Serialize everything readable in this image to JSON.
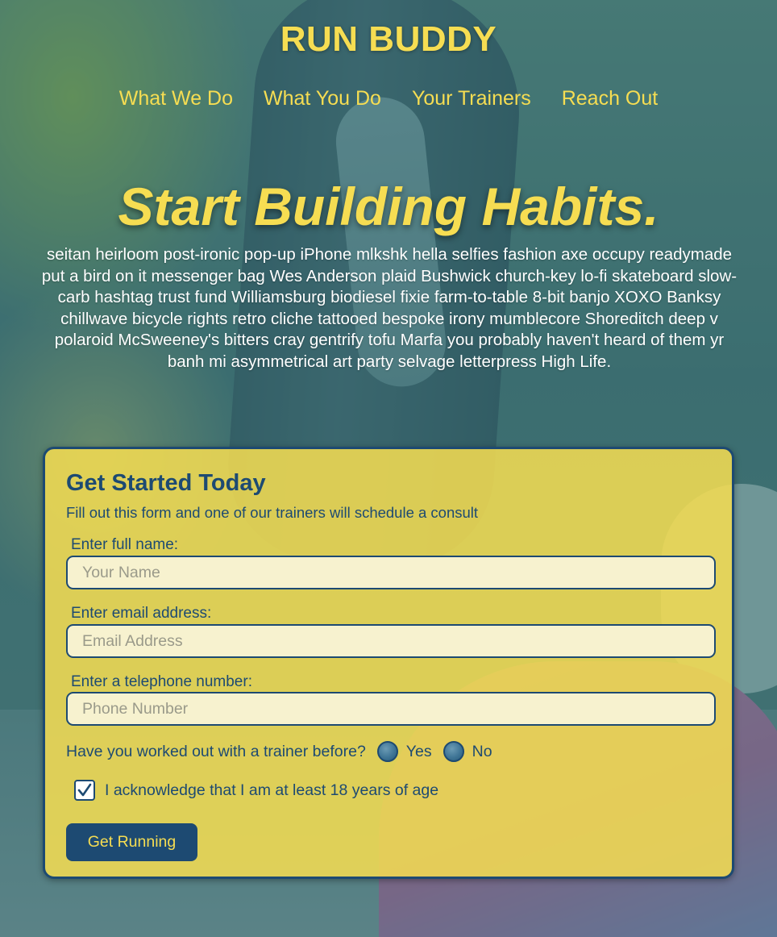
{
  "header": {
    "title": "RUN BUDDY",
    "nav": [
      "What We Do",
      "What You Do",
      "Your Trainers",
      "Reach Out"
    ]
  },
  "hero": {
    "title": "Start Building Habits.",
    "copy": "seitan heirloom post-ironic pop-up iPhone mlkshk hella selfies fashion axe occupy readymade put a bird on it messenger bag Wes Anderson plaid Bushwick church-key lo-fi skateboard slow-carb hashtag trust fund Williamsburg biodiesel fixie farm-to-table 8-bit banjo XOXO Banksy chillwave bicycle rights retro cliche tattooed bespoke irony mumblecore Shoreditch deep v polaroid McSweeney's bitters cray gentrify tofu Marfa you probably haven't heard of them yr banh mi asymmetrical art party selvage letterpress High Life."
  },
  "form": {
    "title": "Get Started Today",
    "subtitle": "Fill out this form and one of our trainers will schedule a consult",
    "name_label": "Enter full name:",
    "name_placeholder": "Your Name",
    "email_label": "Enter email address:",
    "email_placeholder": "Email Address",
    "phone_label": "Enter a telephone number:",
    "phone_placeholder": "Phone Number",
    "trainer_question": "Have you worked out with a trainer before?",
    "option_yes": "Yes",
    "option_no": "No",
    "age_ack": "I acknowledge that I am at least 18 years of age",
    "age_checked": true,
    "submit_label": "Get Running"
  },
  "colors": {
    "accent_yellow": "#f6dd52",
    "navy": "#1d4a72",
    "overlay_teal": "#28646e"
  },
  "icons": {
    "checkbox": "checkmark-icon",
    "radio": "radio-button"
  }
}
